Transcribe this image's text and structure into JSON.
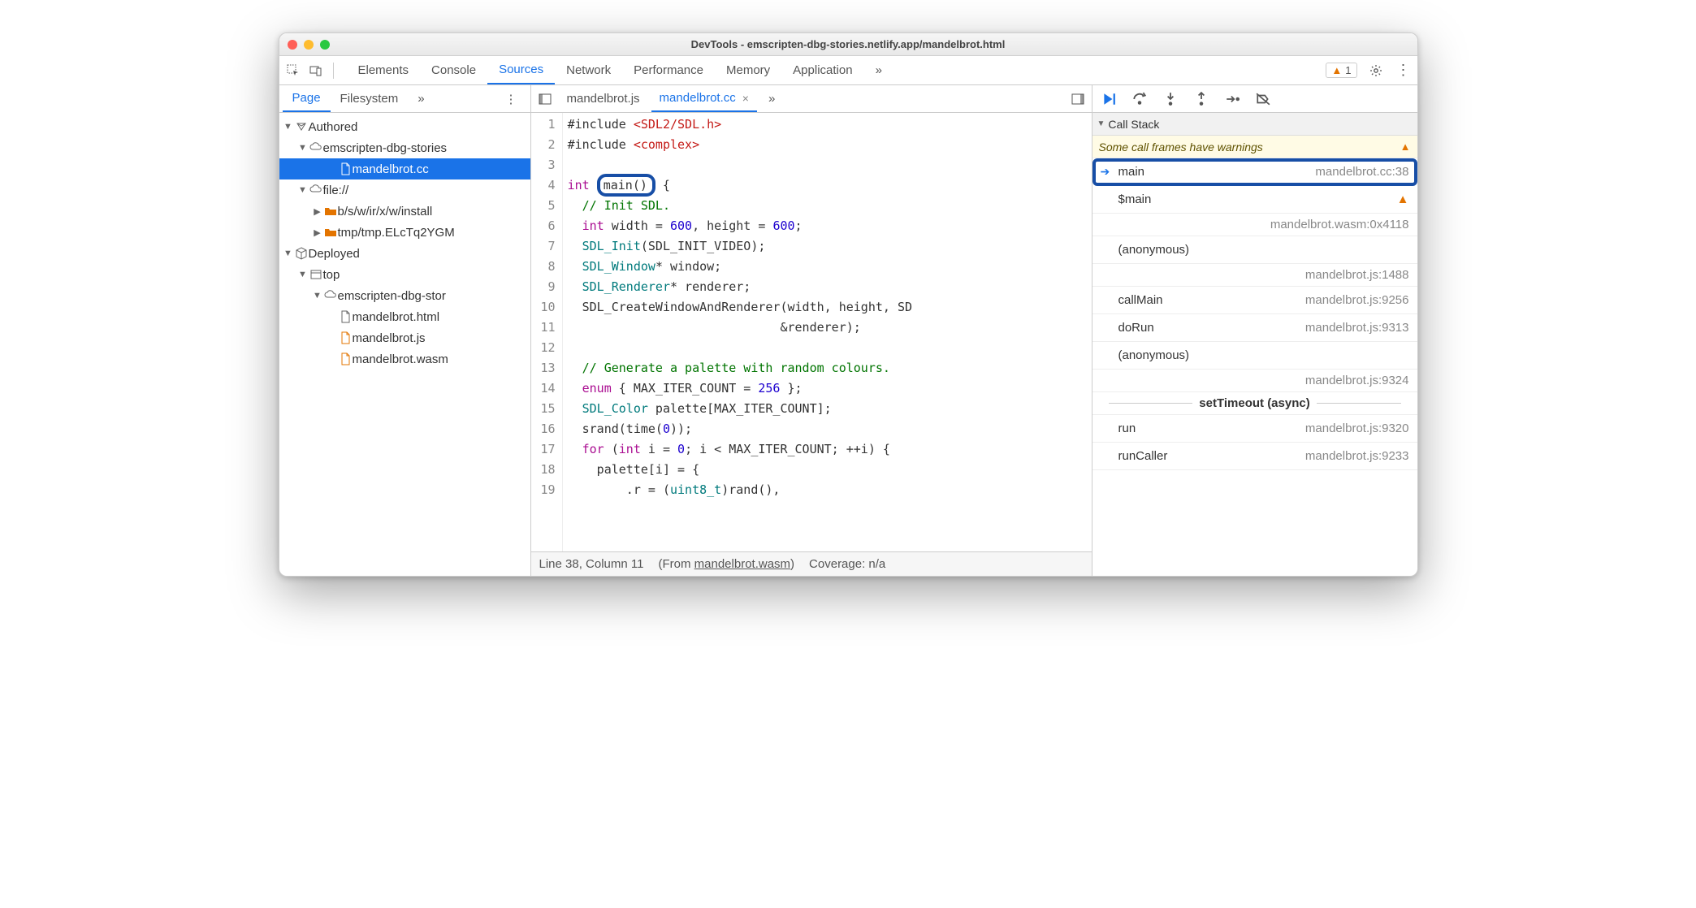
{
  "window": {
    "title": "DevTools - emscripten-dbg-stories.netlify.app/mandelbrot.html"
  },
  "mainTabs": {
    "items": [
      "Elements",
      "Console",
      "Sources",
      "Network",
      "Performance",
      "Memory",
      "Application"
    ],
    "active": "Sources",
    "more": "»",
    "warnCount": "1"
  },
  "navigator": {
    "tabs": {
      "page": "Page",
      "filesystem": "Filesystem",
      "more": "»"
    },
    "tree": {
      "authored": "Authored",
      "cloud1": "emscripten-dbg-stories",
      "file_cc": "mandelbrot.cc",
      "file_proto": "file://",
      "folder1": "b/s/w/ir/x/w/install",
      "folder2": "tmp/tmp.ELcTq2YGM",
      "deployed": "Deployed",
      "top": "top",
      "cloud2": "emscripten-dbg-stor",
      "html": "mandelbrot.html",
      "js": "mandelbrot.js",
      "wasm": "mandelbrot.wasm"
    }
  },
  "editor": {
    "tabs": {
      "t1": "mandelbrot.js",
      "t2": "mandelbrot.cc",
      "more": "»"
    },
    "status": {
      "pos": "Line 38, Column 11",
      "fromLabel": "(From ",
      "fromTarget": "mandelbrot.wasm",
      "fromClose": ")",
      "cov": "Coverage: n/a"
    },
    "code": {
      "l1a": "#include ",
      "l1b": "<SDL2/SDL.h>",
      "l2a": "#include ",
      "l2b": "<complex>",
      "l4a": "int",
      "l4b": "main",
      "l4c": "()",
      "l4d": " {",
      "l5": "// Init SDL.",
      "l6a": "int",
      "l6b": " width = ",
      "l6c": "600",
      "l6d": ", height = ",
      "l6e": "600",
      "l6f": ";",
      "l7a": "SDL_Init",
      "l7b": "(SDL_INIT_VIDEO);",
      "l8a": "SDL_Window",
      "l8b": "* window;",
      "l9a": "SDL_Renderer",
      "l9b": "* renderer;",
      "l10a": "SDL_CreateWindowAndRenderer(width, height, SD",
      "l11a": "                           &renderer);",
      "l13": "// Generate a palette with random colours.",
      "l14a": "enum",
      "l14b": " { MAX_ITER_COUNT = ",
      "l14c": "256",
      "l14d": " };",
      "l15a": "SDL_Color",
      "l15b": " palette[MAX_ITER_COUNT];",
      "l16a": "srand(time(",
      "l16b": "0",
      "l16c": "));",
      "l17a": "for",
      "l17b": " (",
      "l17c": "int",
      "l17d": " i = ",
      "l17e": "0",
      "l17f": "; i < MAX_ITER_COUNT; ++i) {",
      "l18": "  palette[i] = {",
      "l19a": "      .r = (",
      "l19b": "uint8_t",
      "l19c": ")rand(),"
    }
  },
  "debug": {
    "callstack": "Call Stack",
    "warn": "Some call frames have warnings",
    "frames": [
      {
        "name": "main",
        "loc": "mandelbrot.cc:38",
        "active": true
      },
      {
        "name": "$main",
        "loc": "mandelbrot.wasm:0x4118",
        "w": true
      },
      {
        "name": "(anonymous)",
        "loc": "mandelbrot.js:1488"
      },
      {
        "name": "callMain",
        "loc": "mandelbrot.js:9256"
      },
      {
        "name": "doRun",
        "loc": "mandelbrot.js:9313"
      },
      {
        "name": "(anonymous)",
        "loc": "mandelbrot.js:9324"
      }
    ],
    "async": "setTimeout (async)",
    "frames2": [
      {
        "name": "run",
        "loc": "mandelbrot.js:9320"
      },
      {
        "name": "runCaller",
        "loc": "mandelbrot.js:9233"
      }
    ]
  }
}
